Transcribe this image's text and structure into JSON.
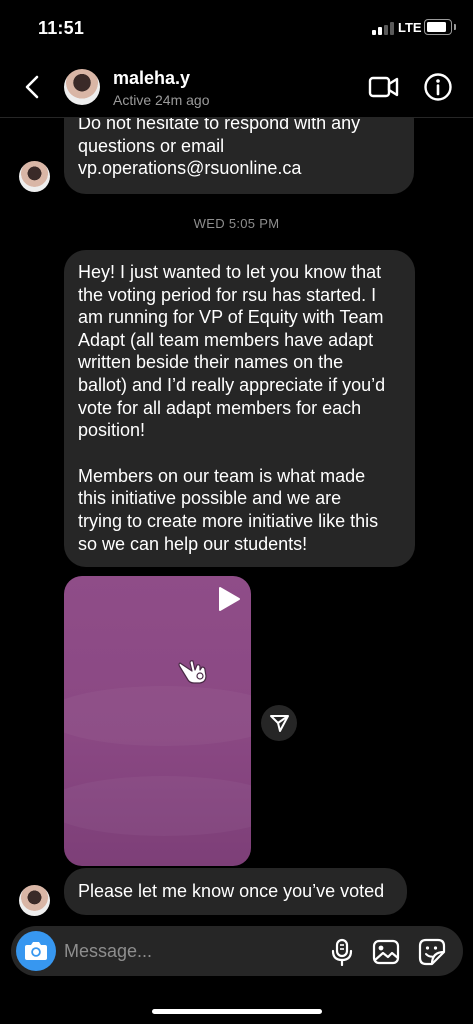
{
  "status_bar": {
    "time": "11:51",
    "network": "LTE",
    "signal_bars": 2,
    "battery_level": 0.85
  },
  "header": {
    "name": "maleha.y",
    "status": "Active 24m ago"
  },
  "thread": {
    "message_1": "Do not hesitate to respond with any\nquestions or email\nvp.operations@rsuonline.ca",
    "timestamp": "WED 5:05 PM",
    "message_2_para_1": "Hey! I just wanted to let you know that\nthe voting period for rsu has started. I\nam running for VP of Equity with Team\nAdapt (all team members have adapt\nwritten beside their names on the\nballot) and I’d really appreciate if you’d\nvote for all adapt members for each\nposition!",
    "message_2_para_2": "Members on our team is what made\nthis initiative possible and we are\ntrying to create more initiative like this\nso we can help our students!",
    "media": {
      "type": "video",
      "color": "#8a4883"
    },
    "message_3": "Please let me know once you’ve voted"
  },
  "composer": {
    "placeholder": "Message..."
  },
  "colors": {
    "bubble": "#262626",
    "accent": "#3797f0",
    "background": "#000000"
  }
}
